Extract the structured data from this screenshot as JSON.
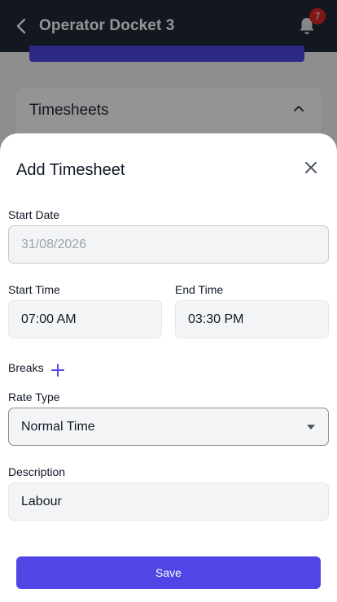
{
  "header": {
    "title": "Operator Docket 3",
    "notification_count": "7"
  },
  "background": {
    "card_title": "Timesheets"
  },
  "sheet": {
    "title": "Add Timesheet",
    "start_date": {
      "label": "Start Date",
      "value": "31/08/2026"
    },
    "start_time": {
      "label": "Start Time",
      "value": "07:00 AM"
    },
    "end_time": {
      "label": "End Time",
      "value": "03:30 PM"
    },
    "breaks": {
      "label": "Breaks"
    },
    "rate_type": {
      "label": "Rate Type",
      "value": "Normal Time"
    },
    "description": {
      "label": "Description",
      "value": "Labour"
    },
    "save_label": "Save"
  },
  "colors": {
    "accent": "#4f46e5",
    "header_bg": "#1f2937",
    "badge": "#dc2626"
  },
  "icons": [
    "back-arrow-icon",
    "bell-icon",
    "chevron-up-icon",
    "close-icon",
    "plus-icon",
    "caret-down-icon"
  ]
}
